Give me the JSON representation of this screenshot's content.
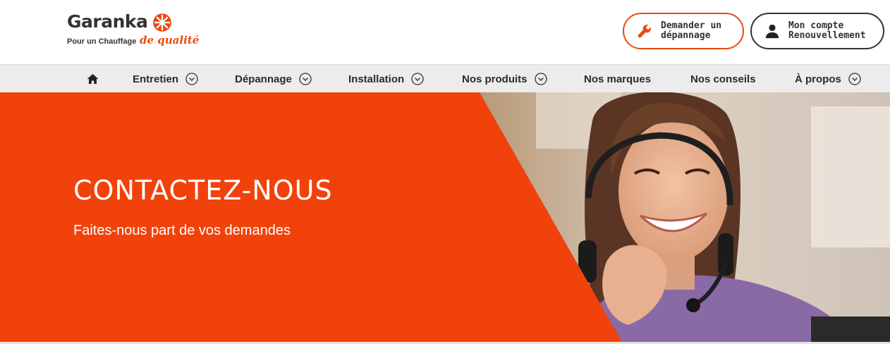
{
  "logo": {
    "wordmark": "Garanka",
    "tagline": "Pour un Chauffage",
    "tagline_script": "de qualité"
  },
  "header_buttons": {
    "depannage": {
      "line1": "Demander un",
      "line2": "dépannage",
      "icon": "wrench-icon"
    },
    "compte": {
      "line1": "Mon compte",
      "line2": "Renouvellement",
      "icon": "user-icon"
    }
  },
  "nav": {
    "home_icon": "home-icon",
    "items": [
      {
        "label": "Entretien",
        "has_dropdown": true
      },
      {
        "label": "Dépannage",
        "has_dropdown": true
      },
      {
        "label": "Installation",
        "has_dropdown": true
      },
      {
        "label": "Nos produits",
        "has_dropdown": true
      },
      {
        "label": "Nos marques",
        "has_dropdown": false
      },
      {
        "label": "Nos conseils",
        "has_dropdown": false
      },
      {
        "label": "À propos",
        "has_dropdown": true
      }
    ]
  },
  "hero": {
    "title": "CONTACTEZ-NOUS",
    "subtitle": "Faites-nous part de vos demandes"
  },
  "colors": {
    "brand_orange": "#f1420c",
    "text_dark": "#2b2b2b",
    "nav_bg": "#ececec"
  }
}
